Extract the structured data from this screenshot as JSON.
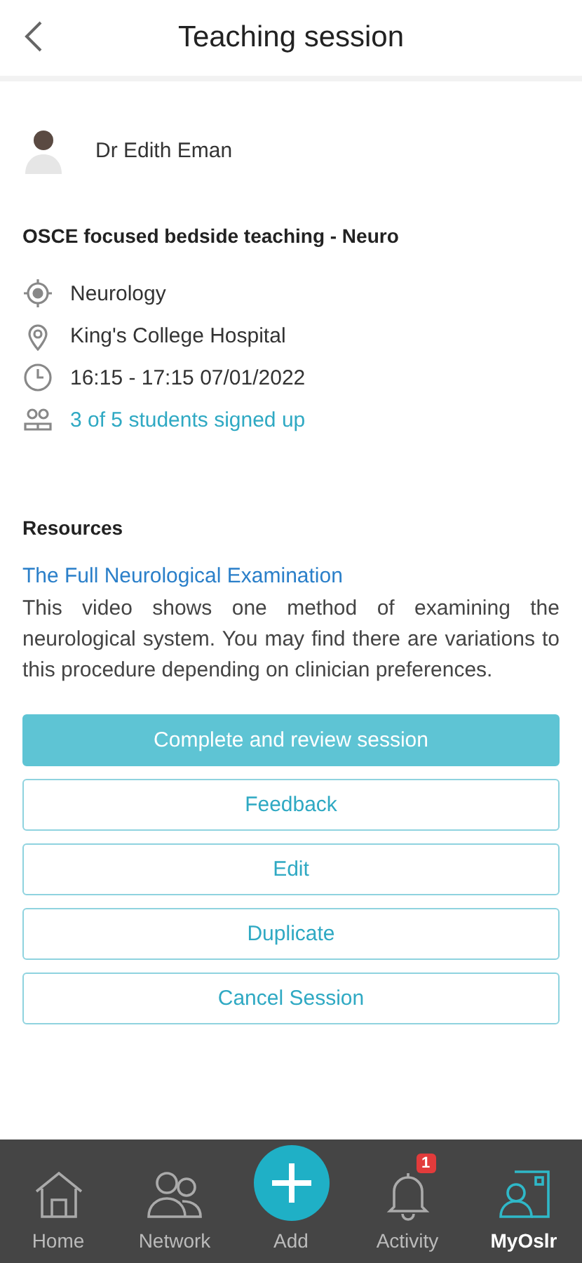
{
  "header": {
    "title": "Teaching session"
  },
  "host": {
    "name": "Dr Edith Eman"
  },
  "session": {
    "title": "OSCE focused bedside teaching - Neuro",
    "details": [
      {
        "kind": "specialty",
        "text": "Neurology",
        "link": false
      },
      {
        "kind": "location",
        "text": "King's College Hospital",
        "link": false
      },
      {
        "kind": "time",
        "text": "16:15 - 17:15 07/01/2022",
        "link": false
      },
      {
        "kind": "students",
        "text": "3 of 5 students signed up",
        "link": true
      }
    ]
  },
  "resources": {
    "heading": "Resources",
    "link": "The Full Neurological Examination",
    "description": "This video shows one method of examining the neurological system. You may find there are variations to this procedure depending on clinician preferences."
  },
  "actions": [
    {
      "label": "Complete and review session",
      "primary": true
    },
    {
      "label": "Feedback",
      "primary": false
    },
    {
      "label": "Edit",
      "primary": false
    },
    {
      "label": "Duplicate",
      "primary": false
    },
    {
      "label": "Cancel Session",
      "primary": false
    }
  ],
  "nav": [
    {
      "kind": "home",
      "label": "Home",
      "selected": false
    },
    {
      "kind": "network",
      "label": "Network",
      "selected": false
    },
    {
      "kind": "add",
      "label": "Add",
      "selected": false
    },
    {
      "kind": "activity",
      "label": "Activity",
      "selected": false,
      "badge": "1"
    },
    {
      "kind": "profile",
      "label": "MyOslr",
      "selected": true
    }
  ]
}
